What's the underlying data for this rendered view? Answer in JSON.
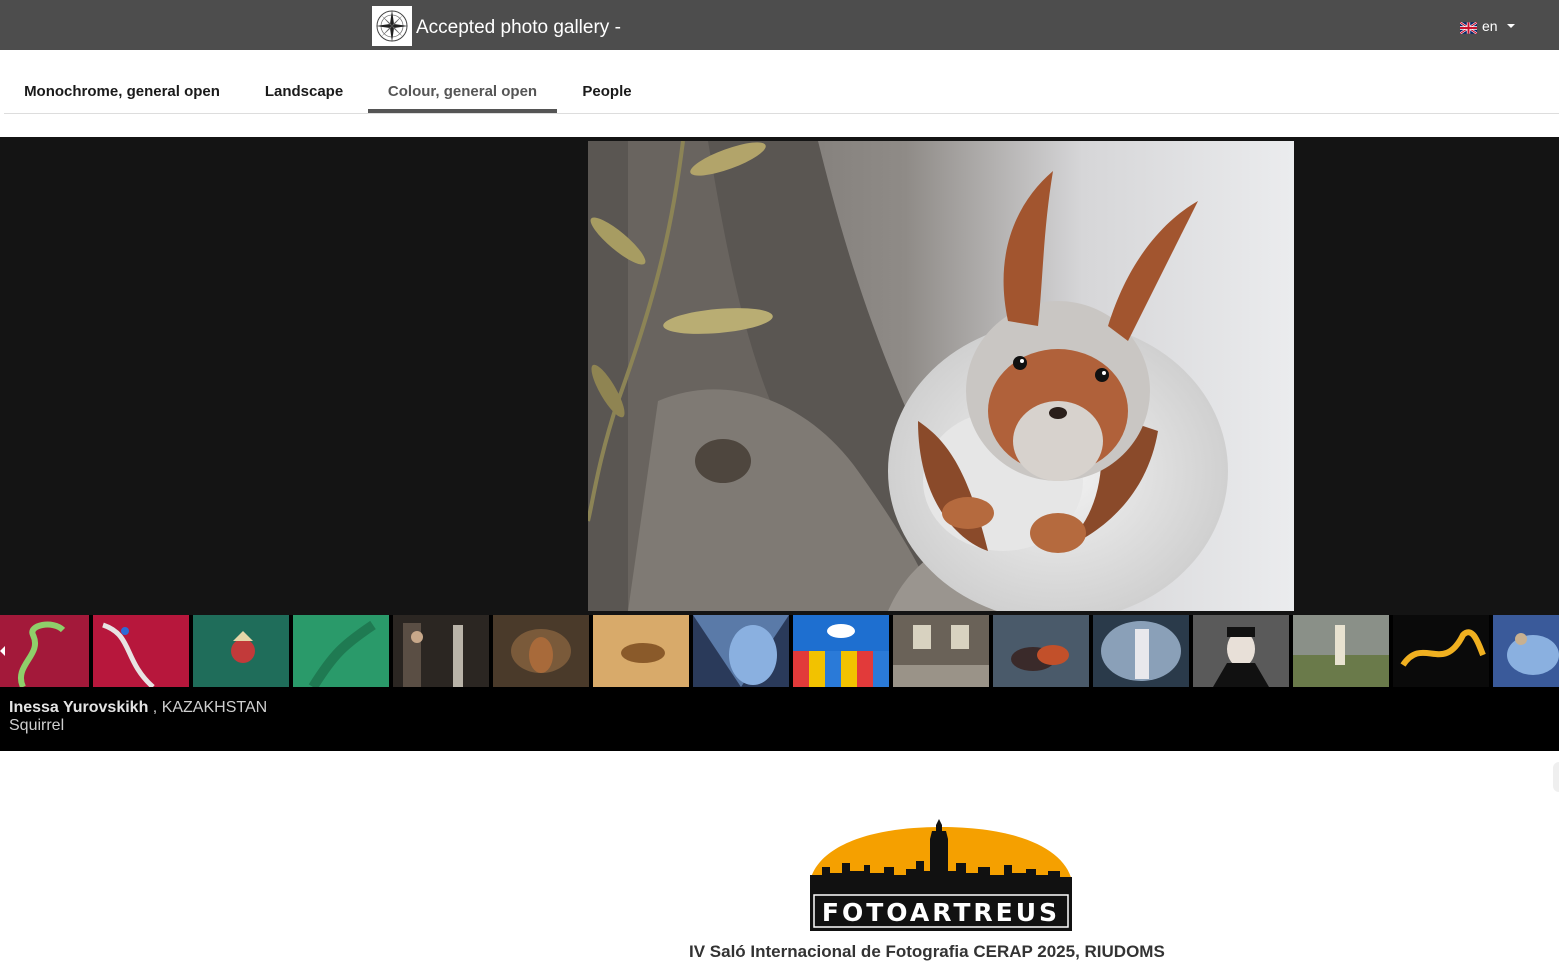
{
  "header": {
    "title": "Accepted photo gallery -",
    "language": "en"
  },
  "tabs": [
    {
      "label": "Monochrome, general open",
      "active": false
    },
    {
      "label": "Landscape",
      "active": false
    },
    {
      "label": "Colour, general open",
      "active": true
    },
    {
      "label": "People",
      "active": false
    }
  ],
  "current_photo": {
    "author": "Inessa Yurovskikh",
    "separator": " , ",
    "country": "KAZAKHSTAN",
    "title": "Squirrel"
  },
  "thumbnails_count": 16,
  "footer": {
    "logo_text": "FOTOARTREUS",
    "salon_title": "IV Saló Internacional de Fotografia CERAP 2025, RIUDOMS"
  },
  "colors": {
    "topbar": "#4d4d4d",
    "viewer_bg": "#141414",
    "active_tab": "#555555",
    "logo_sun": "#f5a000"
  }
}
